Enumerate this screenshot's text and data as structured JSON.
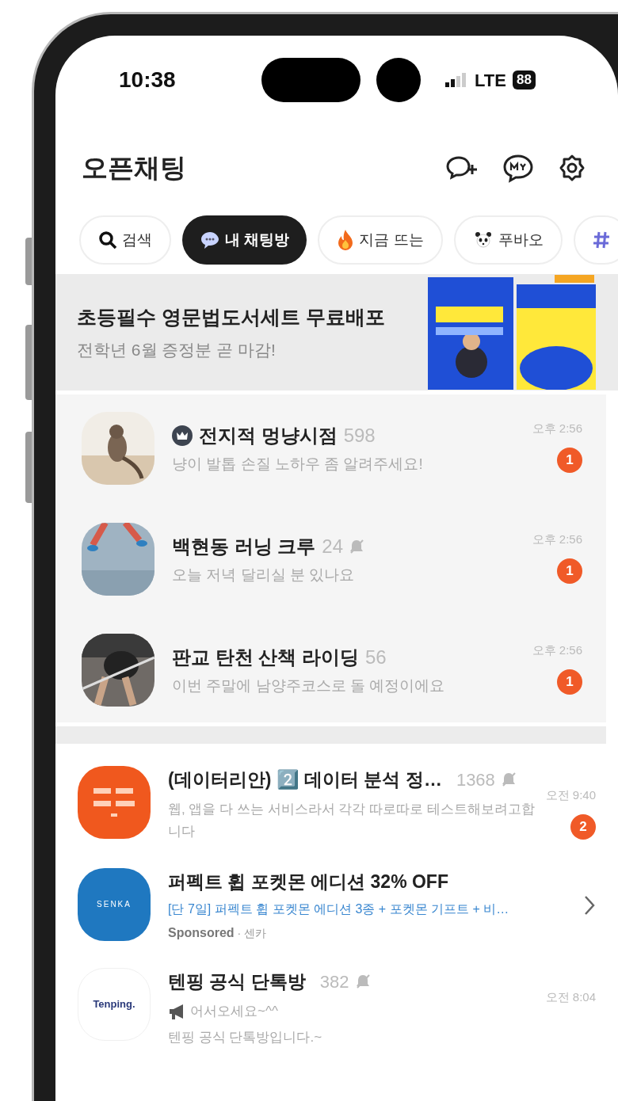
{
  "status_bar": {
    "time": "10:38",
    "network": "LTE",
    "battery": "88"
  },
  "header": {
    "title": "오픈채팅"
  },
  "chips": [
    {
      "kind": "search",
      "label": "검색",
      "selected": false
    },
    {
      "kind": "chat",
      "label": "내 채팅방",
      "selected": true
    },
    {
      "kind": "fire",
      "label": "지금 뜨는",
      "selected": false
    },
    {
      "kind": "panda",
      "label": "푸바오",
      "selected": false
    },
    {
      "kind": "hash",
      "selected": false
    }
  ],
  "banner": {
    "title": "초등필수 영문법도서세트 무료배포",
    "subtitle": "전학년 6월 증정분 곧 마감!"
  },
  "joined_rooms": [
    {
      "name": "전지적 멍냥시점",
      "count": "598",
      "crown": true,
      "muted": false,
      "preview": "냥이 발톱 손질 노하우 좀 알려주세요!",
      "time": "오후 2:56",
      "unread": "1"
    },
    {
      "name": "백현동 러닝 크루",
      "count": "24",
      "crown": false,
      "muted": true,
      "preview": "오늘 저녁 달리실 분 있나요",
      "time": "오후 2:56",
      "unread": "1"
    },
    {
      "name": "판교 탄천 산책 라이딩",
      "count": "56",
      "crown": false,
      "muted": false,
      "preview": "이번 주말에 남양주코스로 돌 예정이에요",
      "time": "오후 2:56",
      "unread": "1"
    }
  ],
  "other_rooms": [
    {
      "kind": "room",
      "name": "(데이터리안) 2️⃣ 데이터 분석 정…",
      "count": "1368",
      "muted": true,
      "preview": "웹, 앱을 다 쓰는 서비스라서 각각 따로따로 테스트해보려고합니다",
      "time": "오전 9:40",
      "unread": "2"
    },
    {
      "kind": "ad",
      "logo_text": "SENKA",
      "name": "퍼펙트 휩 포켓몬 에디션 32% OFF",
      "link": "[단 7일] 퍼펙트 휩 포켓몬 에디션 3종 + 포켓몬 기프트 + 비…",
      "sponsored": "Sponsored",
      "advertiser": "· 센카"
    },
    {
      "kind": "room",
      "logo_text": "Tenping.",
      "name": "텐핑 공식 단톡방",
      "count": "382",
      "muted": true,
      "preview": "어서오세요~^^",
      "megaphone": true,
      "preview_2": "텐핑 공식 단톡방입니다.~",
      "time": "오전 8:04"
    }
  ]
}
